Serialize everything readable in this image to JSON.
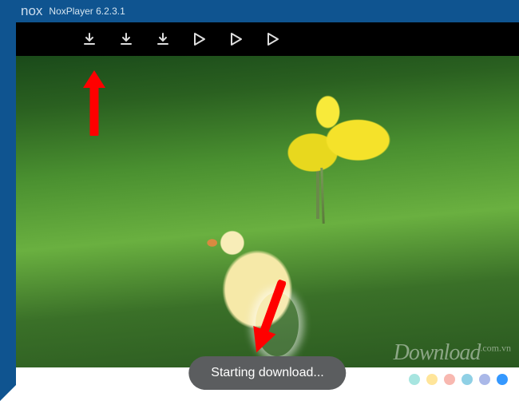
{
  "app": {
    "logo_text": "nox",
    "title": "NoxPlayer 6.2.3.1"
  },
  "toolbar": {
    "icons": [
      {
        "name": "download-1-icon"
      },
      {
        "name": "download-2-icon"
      },
      {
        "name": "download-3-icon"
      },
      {
        "name": "play-1-icon"
      },
      {
        "name": "play-2-icon"
      },
      {
        "name": "play-3-icon"
      }
    ]
  },
  "annotations": {
    "arrow_top": "red-arrow-up",
    "arrow_bottom": "red-arrow-diagonal"
  },
  "toast": {
    "message": "Starting download..."
  },
  "watermark": {
    "text": "Download",
    "suffix": ".com.vn"
  },
  "pager_dots": {
    "colors": [
      "#a7e5e0",
      "#ffe59a",
      "#f8b8b0",
      "#8fd0e5",
      "#aab8e8",
      "#3498ff"
    ]
  }
}
